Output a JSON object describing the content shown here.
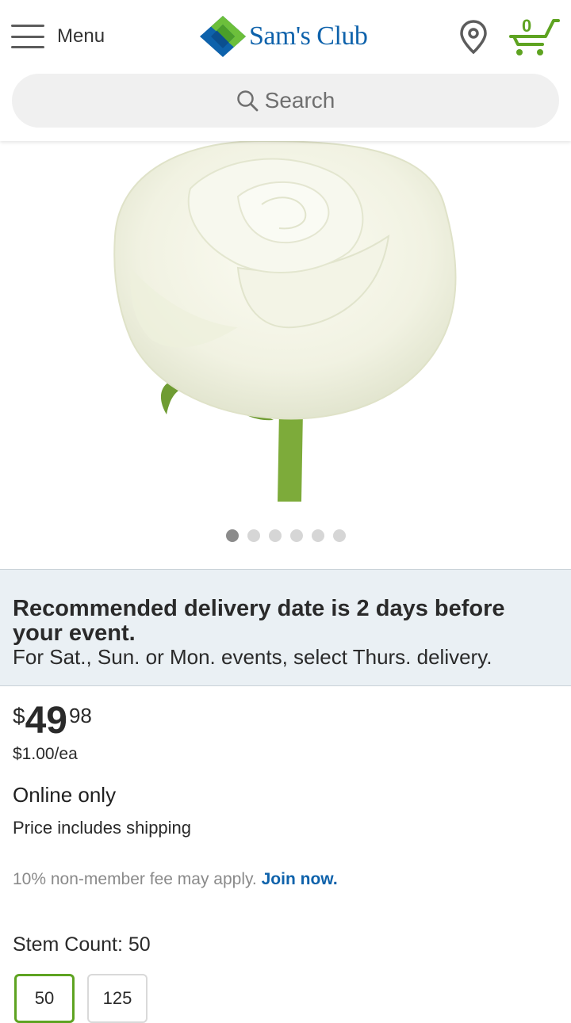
{
  "header": {
    "menu_label": "Menu",
    "brand": "Sam's Club",
    "cart_count": "0",
    "colors": {
      "brand_blue": "#0e62ab",
      "brand_green": "#5ea321"
    }
  },
  "search": {
    "placeholder": "Search"
  },
  "gallery": {
    "slide_count": 6,
    "active_slide": 1
  },
  "notice": {
    "title": "Recommended delivery date is 2 days before your event.",
    "subtitle": "For Sat., Sun. or Mon. events, select Thurs. delivery."
  },
  "price": {
    "currency": "$",
    "dollars": "49",
    "cents": "98",
    "unit_price": "$1.00/ea"
  },
  "availability": "Online only",
  "shipping_note": "Price includes shipping",
  "fee_note": {
    "text": "10% non-member fee may apply.",
    "link": "Join now."
  },
  "stem_count": {
    "label": "Stem Count: 50",
    "options": [
      "50",
      "125"
    ],
    "selected": "50"
  }
}
